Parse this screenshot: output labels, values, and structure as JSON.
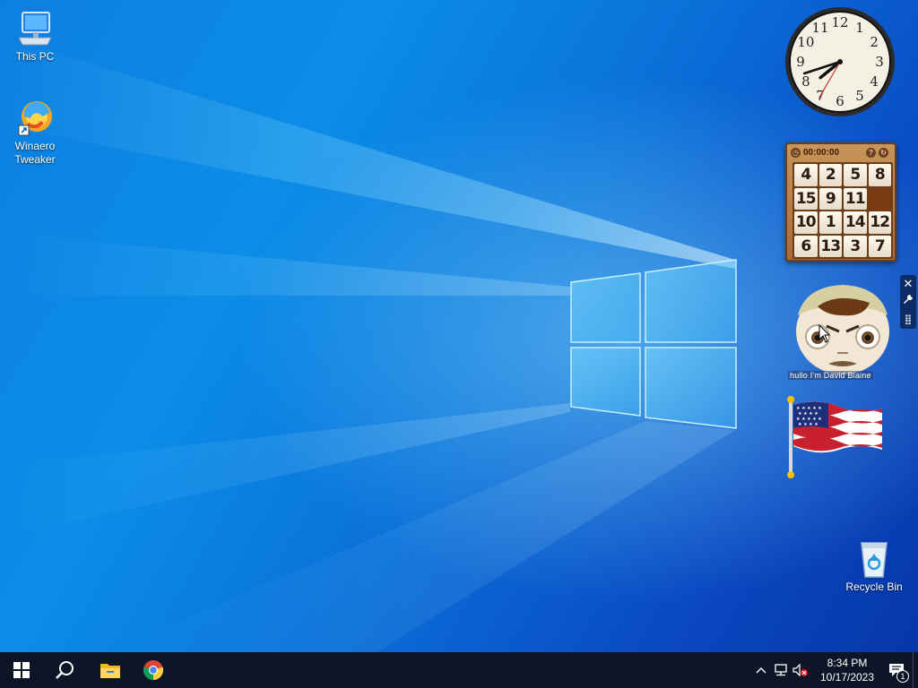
{
  "desktop": {
    "icons": [
      {
        "label": "This PC",
        "icon": "this-pc-icon"
      },
      {
        "label": "Winaero Tweaker",
        "icon": "winaero-tweaker-icon"
      },
      {
        "label": "Recycle Bin",
        "icon": "recycle-bin-icon"
      }
    ],
    "wallpaper": {
      "name": "windows-10-hero",
      "colors": {
        "deep": "#0637a8",
        "mid": "#0b8de8",
        "glow": "#82dcff"
      }
    }
  },
  "gadgets": {
    "clock": {
      "hour": 7,
      "minute": 42,
      "second": 35,
      "numerals": [
        "12",
        "1",
        "2",
        "3",
        "4",
        "5",
        "6",
        "7",
        "8",
        "9",
        "10",
        "11"
      ]
    },
    "puzzle": {
      "timer": "00:00:00",
      "tiles": [
        "4",
        "2",
        "5",
        "8",
        "15",
        "9",
        "11",
        "",
        "10",
        "1",
        "14",
        "12",
        "6",
        "13",
        "3",
        "7"
      ]
    },
    "face": {
      "caption": "hullo I'm David Blaine"
    },
    "flag": {
      "name": "us-flag-icon"
    },
    "controls": {
      "close": "✕",
      "options": "🔧",
      "drag": "⣿"
    }
  },
  "taskbar": {
    "start": "start-icon",
    "search": "search-icon",
    "pinned": [
      "file-explorer-icon",
      "chrome-icon"
    ],
    "tray": {
      "icons": [
        "chevron-up-icon",
        "network-icon",
        "volume-muted-icon"
      ],
      "time": "8:34 PM",
      "date": "10/17/2023",
      "notifications_count": "1"
    },
    "colors": {
      "bar": "#0c1626",
      "text": "#ffffff"
    }
  }
}
